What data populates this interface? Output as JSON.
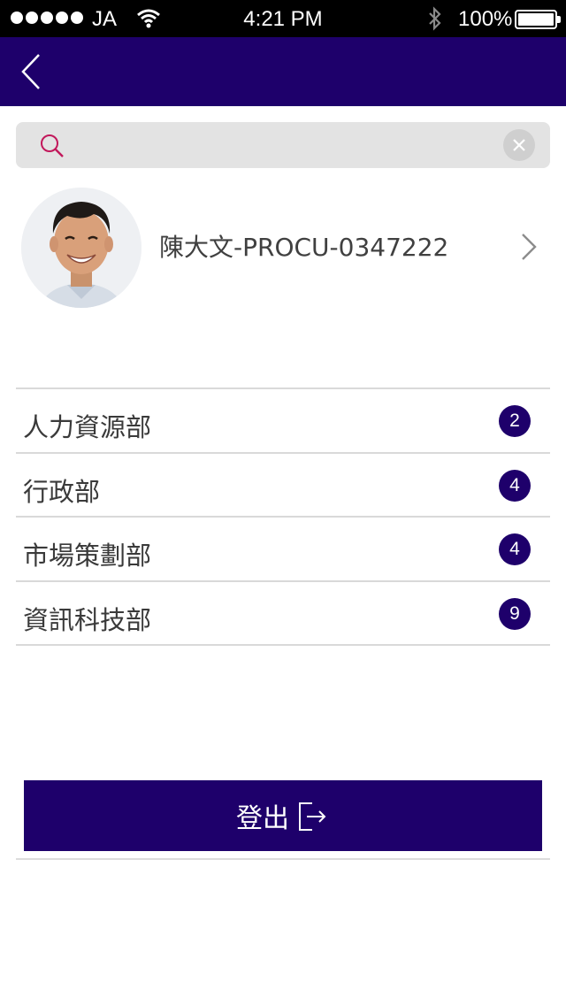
{
  "status_bar": {
    "carrier": "JA",
    "time": "4:21 PM",
    "battery": "100%"
  },
  "nav": {
    "back_icon": "chevron-left-icon"
  },
  "search": {
    "placeholder": "",
    "value": "",
    "search_icon": "search-icon",
    "clear_icon": "close-icon"
  },
  "profile": {
    "name": "陳大文-PROCU-0347222"
  },
  "departments": [
    {
      "label": "人力資源部",
      "count": "2"
    },
    {
      "label": "行政部",
      "count": "4"
    },
    {
      "label": "市場策劃部",
      "count": "4"
    },
    {
      "label": "資訊科技部",
      "count": "9"
    }
  ],
  "logout": {
    "label": "登出",
    "icon": "logout-icon"
  },
  "colors": {
    "brand": "#1e006b",
    "search_icon": "#c2185b"
  }
}
